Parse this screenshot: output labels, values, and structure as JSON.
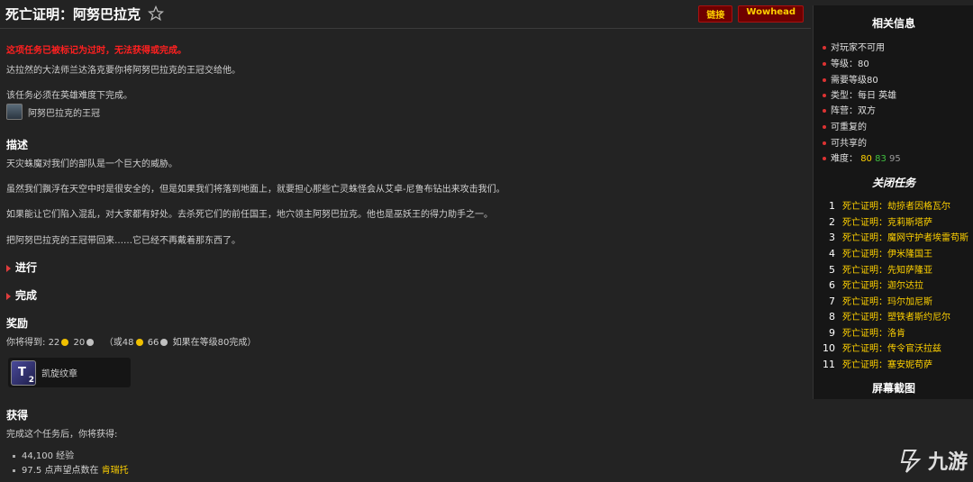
{
  "header": {
    "title": "死亡证明：阿努巴拉克",
    "buttons": {
      "link": "链接",
      "wowhead": "Wowhead"
    }
  },
  "main": {
    "warning": "这项任务已被标记为过时，无法获得或完成。",
    "objective": "达拉然的大法师兰达洛克要你将阿努巴拉克的王冠交给他。",
    "difficulty_note": "该任务必须在英雄难度下完成。",
    "item": "阿努巴拉克的王冠",
    "description_heading": "描述",
    "description": [
      "天灾蛛魔对我们的部队是一个巨大的威胁。",
      "虽然我们飘浮在天空中时是很安全的，但是如果我们将落到地面上，就要担心那些亡灵蛛怪会从艾卓-尼鲁布钻出来攻击我们。",
      "如果能让它们陷入混乱，对大家都有好处。去杀死它们的前任国王，地穴领主阿努巴拉克。他也是巫妖王的得力助手之一。",
      "把阿努巴拉克的王冠带回来……它已经不再戴着那东西了。"
    ],
    "progress_heading": "进行",
    "complete_heading": "完成",
    "rewards_heading": "奖励",
    "rewards_line": {
      "prefix": "你将得到:",
      "gold": "22",
      "silver": "20",
      "alt_prefix": "（或48",
      "alt_silver": "66",
      "alt_suffix": "如果在等级80完成）"
    },
    "reward_item": {
      "name": "凯旋纹章",
      "icon_letter": "T",
      "count": "2"
    },
    "gains_heading": "获得",
    "gains_intro": "完成这个任务后，你将获得:",
    "gains": [
      {
        "text": "44,100 经验",
        "link": ""
      },
      {
        "text": "97.5 点声望点数在",
        "link": "肯瑞托"
      }
    ]
  },
  "sidebar": {
    "heading": "相关信息",
    "info": [
      "对玩家不可用",
      "等级：80",
      "需要等级80",
      "类型：每日 英雄",
      "阵营：双方",
      "可重复的",
      "可共享的"
    ],
    "difficulty": {
      "label": "难度：",
      "values": [
        "80",
        "83",
        "95"
      ]
    },
    "chain_heading": "关闭任务",
    "chain": [
      {
        "num": "1",
        "name": "死亡证明：劫掠者因格瓦尔"
      },
      {
        "num": "2",
        "name": "死亡证明：克莉斯塔萨"
      },
      {
        "num": "3",
        "name": "死亡证明：魔网守护者埃雷苟斯"
      },
      {
        "num": "4",
        "name": "死亡证明：伊米隆国王"
      },
      {
        "num": "5",
        "name": "死亡证明：先知萨隆亚"
      },
      {
        "num": "6",
        "name": "死亡证明：迦尔达拉"
      },
      {
        "num": "7",
        "name": "死亡证明：玛尔加尼斯"
      },
      {
        "num": "8",
        "name": "死亡证明：塑铁者斯约尼尔"
      },
      {
        "num": "9",
        "name": "死亡证明：洛肯"
      },
      {
        "num": "10",
        "name": "死亡证明：传令官沃拉兹"
      },
      {
        "num": "11",
        "name": "死亡证明：塞安妮苟萨"
      }
    ],
    "screenshot_heading": "屏幕截图"
  },
  "watermark": {
    "text": "九游"
  },
  "icons": {
    "star": "star-outline-icon",
    "item": "crown-item-icon",
    "reward": "emblem-of-triumph-icon"
  }
}
